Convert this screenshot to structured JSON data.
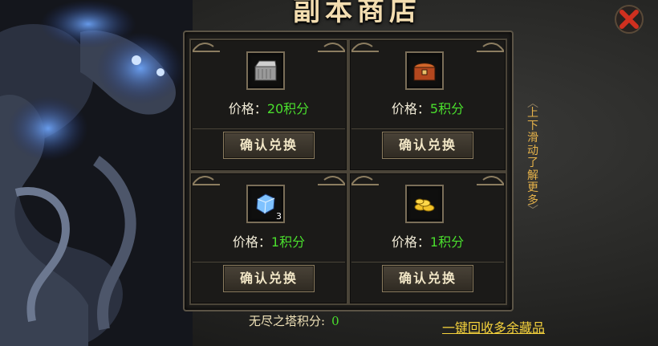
{
  "shop": {
    "title": "副本商店",
    "items": [
      {
        "icon": "silver-chest-icon",
        "price_label": "价格：",
        "price_value": "20积分",
        "button": "确认兑换"
      },
      {
        "icon": "red-chest-icon",
        "price_label": "价格：",
        "price_value": "5积分",
        "button": "确认兑换"
      },
      {
        "icon": "blue-crystal-icon",
        "quantity": "3",
        "price_label": "价格：",
        "price_value": "1积分",
        "button": "确认兑换"
      },
      {
        "icon": "gold-coins-icon",
        "price_label": "价格：",
        "price_value": "1积分",
        "button": "确认兑换"
      }
    ],
    "scroll_hint": [
      "上",
      "下",
      "滑",
      "动",
      "了",
      "解",
      "更",
      "多"
    ],
    "score_label": "无尽之塔积分:",
    "score_value": "0",
    "recycle_link": "一键回收多余藏品",
    "colors": {
      "price_value": "#4ade2d",
      "link": "#f5d23c",
      "title": "#f3ddb0",
      "hint": "#e6b24a"
    }
  }
}
